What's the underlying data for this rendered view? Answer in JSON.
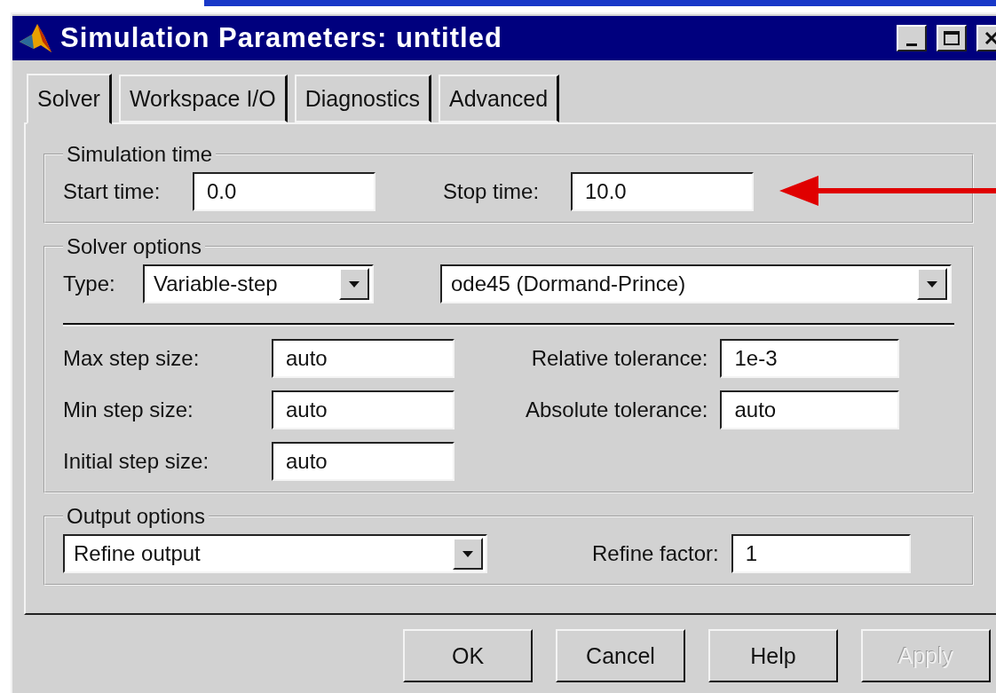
{
  "window": {
    "title": "Simulation Parameters: untitled"
  },
  "tabs": [
    {
      "label": "Solver",
      "selected": true
    },
    {
      "label": "Workspace I/O",
      "selected": false
    },
    {
      "label": "Diagnostics",
      "selected": false
    },
    {
      "label": "Advanced",
      "selected": false
    }
  ],
  "simulation_time": {
    "title": "Simulation time",
    "start_time": {
      "label": "Start time:",
      "value": "0.0"
    },
    "stop_time": {
      "label": "Stop time:",
      "value": "10.0"
    }
  },
  "solver_options": {
    "title": "Solver options",
    "type": {
      "label": "Type:",
      "value": "Variable-step"
    },
    "solver": {
      "value": "ode45 (Dormand-Prince)"
    },
    "step_sizes": [
      {
        "label": "Max step size:",
        "value": "auto"
      },
      {
        "label": "Min step size:",
        "value": "auto"
      },
      {
        "label": "Initial step size:",
        "value": "auto"
      }
    ],
    "tolerances": [
      {
        "label": "Relative tolerance:",
        "value": "1e-3"
      },
      {
        "label": "Absolute tolerance:",
        "value": "auto"
      }
    ]
  },
  "output_options": {
    "title": "Output options",
    "mode": {
      "value": "Refine output"
    },
    "refine_factor": {
      "label": "Refine factor:",
      "value": "1"
    }
  },
  "buttons": [
    {
      "label": "OK",
      "disabled": false
    },
    {
      "label": "Cancel",
      "disabled": false
    },
    {
      "label": "Help",
      "disabled": false
    },
    {
      "label": "Apply",
      "disabled": true
    }
  ]
}
